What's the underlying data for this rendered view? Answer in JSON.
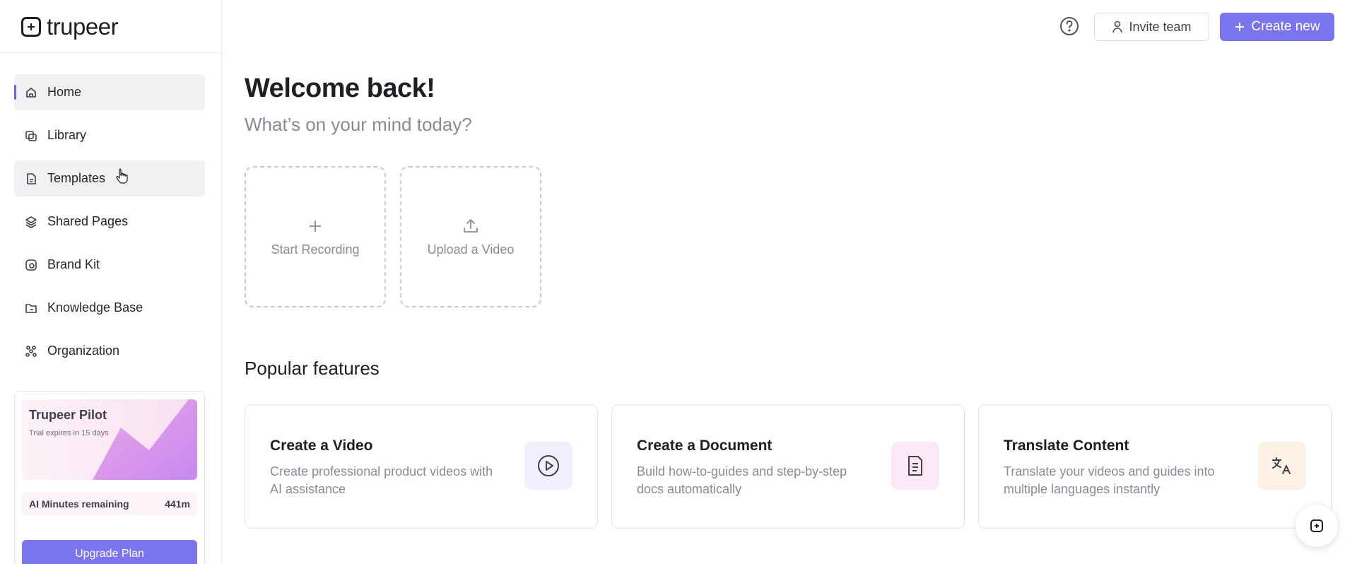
{
  "brand": {
    "name": "trupeer"
  },
  "sidebar": {
    "items": [
      {
        "label": "Home",
        "icon": "home-icon",
        "active": true
      },
      {
        "label": "Library",
        "icon": "library-icon"
      },
      {
        "label": "Templates",
        "icon": "templates-icon"
      },
      {
        "label": "Shared Pages",
        "icon": "layers-icon"
      },
      {
        "label": "Brand Kit",
        "icon": "brand-kit-icon"
      },
      {
        "label": "Knowledge Base",
        "icon": "folder-icon"
      },
      {
        "label": "Organization",
        "icon": "organization-icon"
      }
    ],
    "pilot": {
      "title": "Trupeer Pilot",
      "subtitle": "Trial expires in 15 days",
      "minutes_label": "AI Minutes remaining",
      "minutes_value": "441m",
      "upgrade_label": "Upgrade Plan"
    }
  },
  "header": {
    "invite_label": "Invite team",
    "create_label": "Create new"
  },
  "main": {
    "welcome": "Welcome back!",
    "subtitle": "What’s on your mind today?",
    "actions": [
      {
        "label": "Start Recording",
        "icon": "plus-icon"
      },
      {
        "label": "Upload a Video",
        "icon": "upload-icon"
      }
    ],
    "popular_title": "Popular features",
    "features": [
      {
        "title": "Create a Video",
        "description": "Create professional product videos with AI assistance",
        "icon": "play-circle-icon",
        "icon_bg": "#f1effd"
      },
      {
        "title": "Create a Document",
        "description": "Build how-to-guides and step-by-step docs automatically",
        "icon": "document-icon",
        "icon_bg": "#fce8f6"
      },
      {
        "title": "Translate Content",
        "description": "Translate your videos and guides into multiple languages instantly",
        "icon": "translate-icon",
        "icon_bg": "#fdf1e6"
      }
    ]
  },
  "colors": {
    "accent": "#7b74ef",
    "active_indicator": "#6d63e8"
  }
}
